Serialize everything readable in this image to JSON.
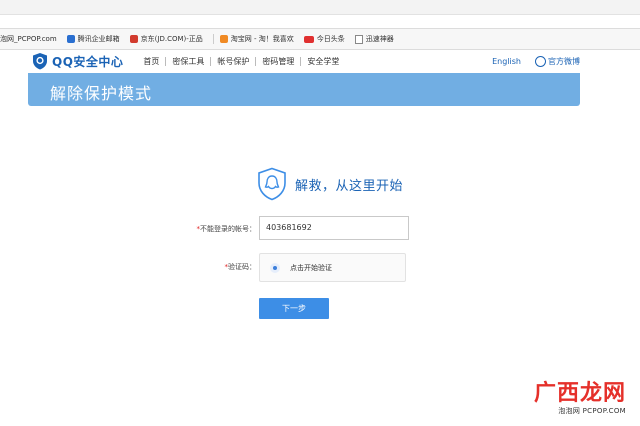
{
  "browser": {
    "bookmarks": [
      {
        "label": "泡网_PCPOP.com",
        "icon": "none"
      },
      {
        "label": "腾讯企业邮箱",
        "icon": "blue"
      },
      {
        "label": "京东(JD.COM)-正品",
        "icon": "red"
      },
      {
        "label": "淘宝网 - 淘！我喜欢",
        "icon": "orange"
      },
      {
        "label": "今日头条",
        "icon": "tt"
      },
      {
        "label": "迅速神器",
        "icon": "page"
      }
    ]
  },
  "header": {
    "logo_text": "QQ安全中心",
    "nav": [
      "首页",
      "密保工具",
      "帐号保护",
      "密码管理",
      "安全学堂"
    ],
    "language": "English",
    "weibo": "官方微博"
  },
  "banner": {
    "title": "解除保护模式"
  },
  "main": {
    "hero_text": "解救，从这里开始",
    "account_label_req": "*",
    "account_label": "不能登录的帐号：",
    "account_value": "403681692",
    "captcha_label_req": "*",
    "captcha_label": "验证码：",
    "captcha_text": "点击开始验证",
    "next_button": "下一步"
  },
  "watermark": {
    "big": "广西龙网",
    "small": "泡泡网 PCPOP.COM"
  },
  "colors": {
    "brand_blue": "#1b63b5",
    "banner": "#71aee3",
    "button": "#3d8ee6",
    "required": "#e02020"
  }
}
